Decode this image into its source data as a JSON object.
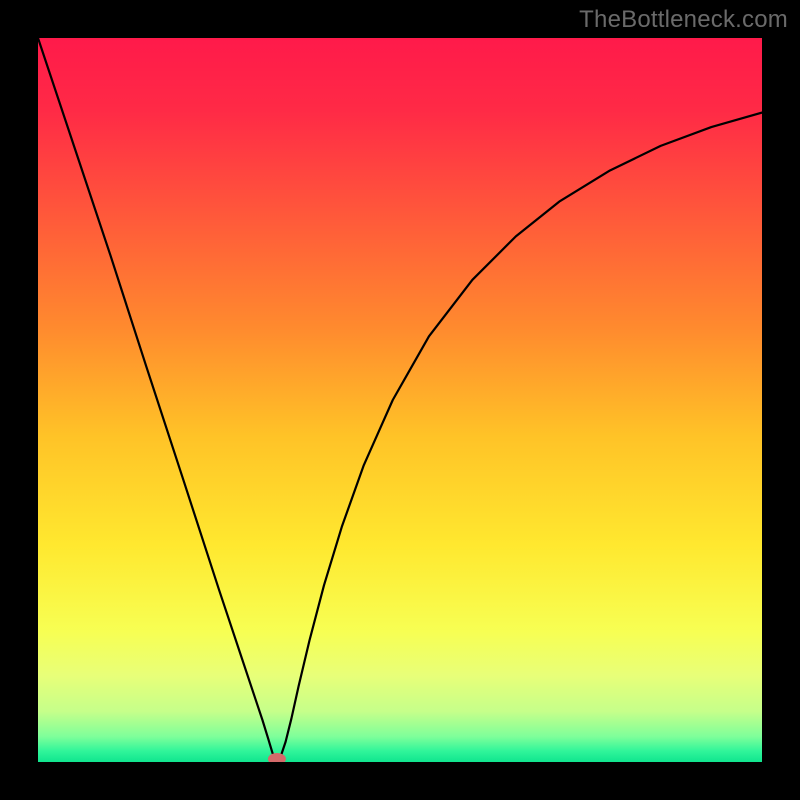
{
  "watermark": "TheBottleneck.com",
  "chart_data": {
    "type": "line",
    "title": "",
    "xlabel": "",
    "ylabel": "",
    "xlim": [
      0,
      1
    ],
    "ylim": [
      0,
      1
    ],
    "background_gradient_stops": [
      {
        "offset": 0.0,
        "color": "#ff1a4a"
      },
      {
        "offset": 0.1,
        "color": "#ff2a46"
      },
      {
        "offset": 0.25,
        "color": "#ff5a3a"
      },
      {
        "offset": 0.4,
        "color": "#ff8a2e"
      },
      {
        "offset": 0.55,
        "color": "#ffc327"
      },
      {
        "offset": 0.7,
        "color": "#ffe82f"
      },
      {
        "offset": 0.82,
        "color": "#f7ff53"
      },
      {
        "offset": 0.88,
        "color": "#e8ff78"
      },
      {
        "offset": 0.93,
        "color": "#c6ff8a"
      },
      {
        "offset": 0.965,
        "color": "#7eff9a"
      },
      {
        "offset": 0.985,
        "color": "#30f59a"
      },
      {
        "offset": 1.0,
        "color": "#10e58f"
      }
    ],
    "series": [
      {
        "name": "bottleneck-curve",
        "x": [
          0.0,
          0.05,
          0.1,
          0.15,
          0.2,
          0.25,
          0.28,
          0.3,
          0.31,
          0.318,
          0.324,
          0.33,
          0.336,
          0.342,
          0.35,
          0.36,
          0.375,
          0.395,
          0.42,
          0.45,
          0.49,
          0.54,
          0.6,
          0.66,
          0.72,
          0.79,
          0.86,
          0.93,
          1.0
        ],
        "y": [
          1.0,
          0.85,
          0.7,
          0.545,
          0.392,
          0.238,
          0.148,
          0.088,
          0.058,
          0.032,
          0.012,
          0.002,
          0.01,
          0.028,
          0.06,
          0.105,
          0.168,
          0.244,
          0.326,
          0.41,
          0.5,
          0.588,
          0.666,
          0.726,
          0.774,
          0.817,
          0.851,
          0.877,
          0.897
        ]
      }
    ],
    "marker": {
      "x": 0.33,
      "y": 0.0,
      "color": "#d46a6a"
    }
  }
}
